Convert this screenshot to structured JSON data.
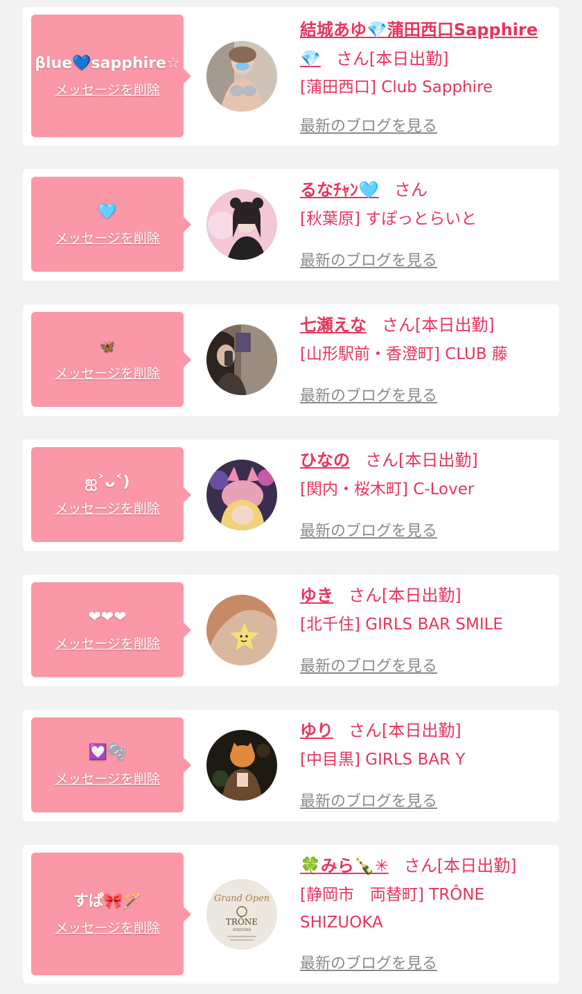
{
  "colors": {
    "background": "#f2f2f2",
    "card": "#ffffff",
    "bubble": "#fb98a7",
    "accent": "#e8345d",
    "link_gray": "#8a8a8a"
  },
  "delete_label": "メッセージを削除",
  "blog_label": "最新のブログを見る",
  "entries": [
    {
      "message": "βlue💙sapphire☆",
      "name": "結城あゆ💎蒲田西口Sapphire💎",
      "suffix": "さん[本日出勤]",
      "shop": "[蒲田西口] Club Sapphire",
      "avatar_icon": "profile-photo"
    },
    {
      "message": "🩵",
      "name": "るなﾁｬﾝ🩵",
      "suffix": "さん",
      "shop": "[秋葉原] すぽっとらいと",
      "avatar_icon": "profile-photo"
    },
    {
      "message": "🦋",
      "name": "七瀬えな",
      "suffix": "さん[本日出勤]",
      "shop": "[山形駅前・香澄町] CLUB 藤",
      "avatar_icon": "profile-photo"
    },
    {
      "message": "ஐ˃ᴗ˂)",
      "name": "ひなの",
      "suffix": "さん[本日出勤]",
      "shop": "[関内・桜木町] C-Lover",
      "avatar_icon": "profile-photo"
    },
    {
      "message": "❤❤❤",
      "name": "ゆき",
      "suffix": "さん[本日出勤]",
      "shop": "[北千住] GIRLS BAR SMILE",
      "avatar_icon": "profile-photo-star-sticker"
    },
    {
      "message": "💟🫧",
      "name": "ゆり",
      "suffix": "さん[本日出勤]",
      "shop": "[中目黒] GIRLS BAR Y",
      "avatar_icon": "profile-photo"
    },
    {
      "message": "すぱ🎀🪄",
      "name": "🍀みら🍾✳",
      "suffix": "さん[本日出勤]",
      "shop": "[静岡市　両替町] TRÔNE SHIZUOKA",
      "avatar_icon": "grand-open-logo",
      "avatar_text": {
        "top": "Grand Open",
        "brand": "TRÔNE",
        "sub": "SHIZUOKA"
      }
    }
  ]
}
